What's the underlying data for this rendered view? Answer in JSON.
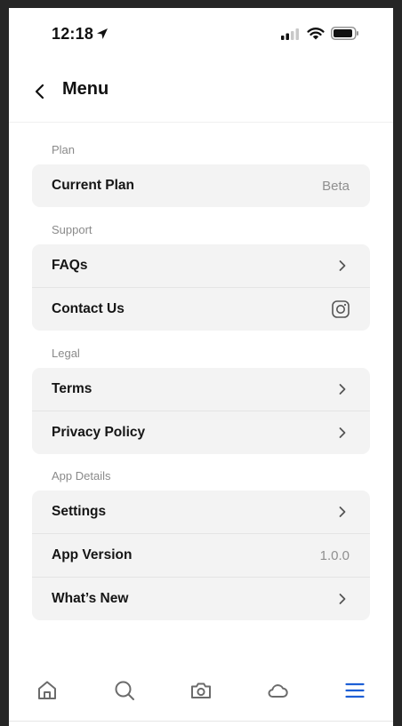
{
  "status": {
    "time": "12:18"
  },
  "header": {
    "title": "Menu"
  },
  "sections": {
    "plan": {
      "label": "Plan",
      "current_plan": {
        "label": "Current Plan",
        "value": "Beta"
      }
    },
    "support": {
      "label": "Support",
      "faqs": {
        "label": "FAQs"
      },
      "contact": {
        "label": "Contact Us"
      }
    },
    "legal": {
      "label": "Legal",
      "terms": {
        "label": "Terms"
      },
      "privacy": {
        "label": "Privacy Policy"
      }
    },
    "app_details": {
      "label": "App Details",
      "settings": {
        "label": "Settings"
      },
      "version": {
        "label": "App Version",
        "value": "1.0.0"
      },
      "whats_new": {
        "label": "What’s New"
      }
    }
  },
  "tabbar": {
    "items": [
      "home-icon",
      "search-icon",
      "camera-icon",
      "cloud-icon",
      "menu-icon"
    ],
    "active": "menu-icon",
    "active_color": "#1d5fd6",
    "inactive_color": "#6b6b6b"
  }
}
